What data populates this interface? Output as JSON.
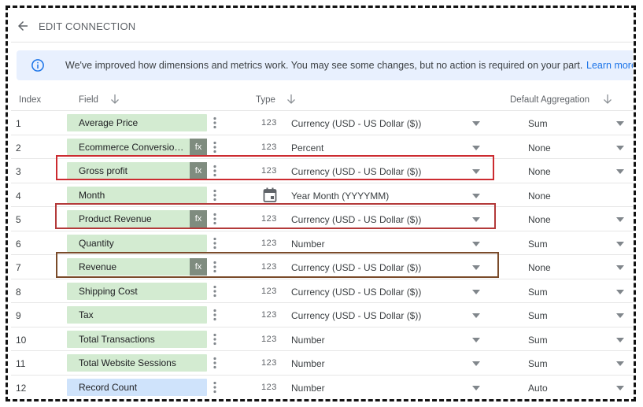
{
  "header": {
    "title": "EDIT CONNECTION"
  },
  "banner": {
    "text": "We've improved how dimensions and metrics work. You may see some changes, but no action is required on your part.",
    "link": "Learn more"
  },
  "columns": {
    "index": "Index",
    "field": "Field",
    "type": "Type",
    "aggregation": "Default Aggregation"
  },
  "colors": {
    "metric_chip": "#d3ebd1",
    "dimension_chip": "#cfe3fb",
    "highlight_red": "#cc2b30",
    "highlight_brown": "#7a4b2a",
    "link": "#1a73e8"
  },
  "rows": [
    {
      "index": "1",
      "field": "Average Price",
      "calc": false,
      "type_icon": "123",
      "type": "Currency (USD - US Dollar ($))",
      "agg": "Sum"
    },
    {
      "index": "2",
      "field": "Ecommerce Conversion Rate",
      "calc": true,
      "type_icon": "123",
      "type": "Percent",
      "agg": "None"
    },
    {
      "index": "3",
      "field": "Gross profit",
      "calc": true,
      "type_icon": "123",
      "type": "Currency (USD - US Dollar ($))",
      "agg": "None"
    },
    {
      "index": "4",
      "field": "Month",
      "calc": false,
      "type_icon": "calendar",
      "type": "Year Month (YYYYMM)",
      "agg": "None"
    },
    {
      "index": "5",
      "field": "Product Revenue",
      "calc": true,
      "type_icon": "123",
      "type": "Currency (USD - US Dollar ($))",
      "agg": "None"
    },
    {
      "index": "6",
      "field": "Quantity",
      "calc": false,
      "type_icon": "123",
      "type": "Number",
      "agg": "Sum"
    },
    {
      "index": "7",
      "field": "Revenue",
      "calc": true,
      "type_icon": "123",
      "type": "Currency (USD - US Dollar ($))",
      "agg": "None"
    },
    {
      "index": "8",
      "field": "Shipping Cost",
      "calc": false,
      "type_icon": "123",
      "type": "Currency (USD - US Dollar ($))",
      "agg": "Sum"
    },
    {
      "index": "9",
      "field": "Tax",
      "calc": false,
      "type_icon": "123",
      "type": "Currency (USD - US Dollar ($))",
      "agg": "Sum"
    },
    {
      "index": "10",
      "field": "Total Transactions",
      "calc": false,
      "type_icon": "123",
      "type": "Number",
      "agg": "Sum"
    },
    {
      "index": "11",
      "field": "Total Website Sessions",
      "calc": false,
      "type_icon": "123",
      "type": "Number",
      "agg": "Sum"
    },
    {
      "index": "12",
      "field": "Record Count",
      "calc": false,
      "type_icon": "123",
      "type": "Number",
      "agg": "Auto"
    }
  ],
  "fx_label": "fx"
}
